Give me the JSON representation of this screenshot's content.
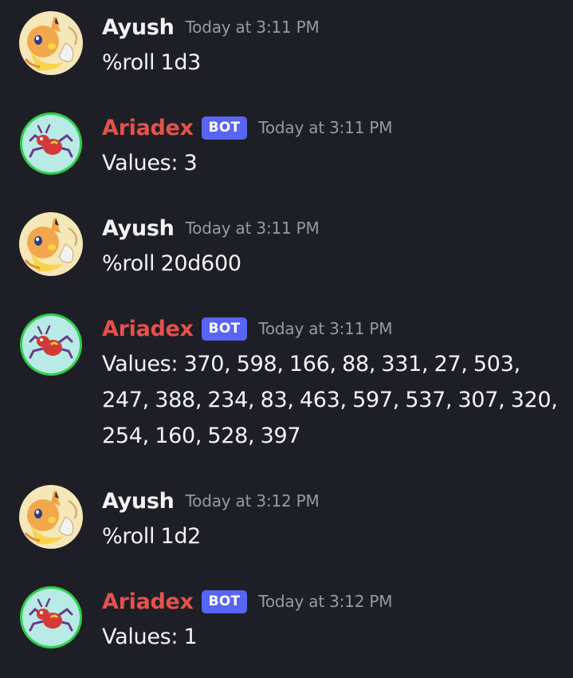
{
  "messages": [
    {
      "author": "Ayush",
      "is_bot": false,
      "timestamp": "Today at 3:11 PM",
      "content": "%roll 1d3",
      "avatar_icon": "pikachu-pokemon-icon"
    },
    {
      "author": "Ariadex",
      "is_bot": true,
      "bot_tag": "BOT",
      "timestamp": "Today at 3:11 PM",
      "content": "Values: 3",
      "avatar_icon": "ariados-spider-icon"
    },
    {
      "author": "Ayush",
      "is_bot": false,
      "timestamp": "Today at 3:11 PM",
      "content": "%roll 20d600",
      "avatar_icon": "pikachu-pokemon-icon"
    },
    {
      "author": "Ariadex",
      "is_bot": true,
      "bot_tag": "BOT",
      "timestamp": "Today at 3:11 PM",
      "content": "Values: 370, 598, 166, 88, 331, 27, 503, 247, 388, 234, 83, 463, 597, 537, 307, 320, 254, 160, 528, 397",
      "avatar_icon": "ariados-spider-icon"
    },
    {
      "author": "Ayush",
      "is_bot": false,
      "timestamp": "Today at 3:12 PM",
      "content": "%roll 1d2",
      "avatar_icon": "pikachu-pokemon-icon"
    },
    {
      "author": "Ariadex",
      "is_bot": true,
      "bot_tag": "BOT",
      "timestamp": "Today at 3:12 PM",
      "content": "Values: 1",
      "avatar_icon": "ariados-spider-icon"
    }
  ],
  "colors": {
    "background": "#1e1f26",
    "bot_name": "#e4524b",
    "bot_tag": "#5865f2",
    "timestamp": "#949ba4",
    "text": "#f2f3f5"
  }
}
